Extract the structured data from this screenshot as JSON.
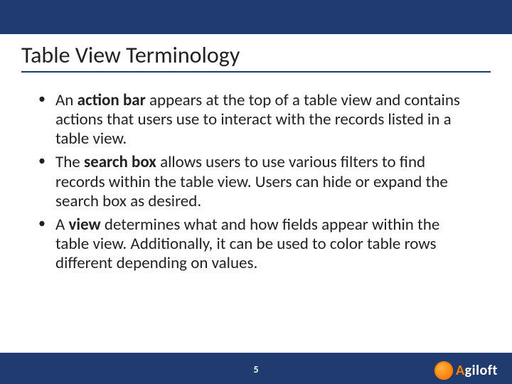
{
  "title": "Table View Terminology",
  "bullets": [
    {
      "pre": "An ",
      "bold": "action bar",
      "post": " appears at the top of a table view and contains actions that users use to interact with the records listed in a table view."
    },
    {
      "pre": "The ",
      "bold": "search box",
      "post": " allows users to use various filters to find records within the table view. Users can hide or expand the search box as desired."
    },
    {
      "pre": "A ",
      "bold": "view",
      "post": " determines what and how fields appear within the table view. Additionally, it can be used to color table rows different depending on values."
    }
  ],
  "page_number": "5",
  "logo": {
    "part1": "A",
    "part2": "giloft"
  }
}
